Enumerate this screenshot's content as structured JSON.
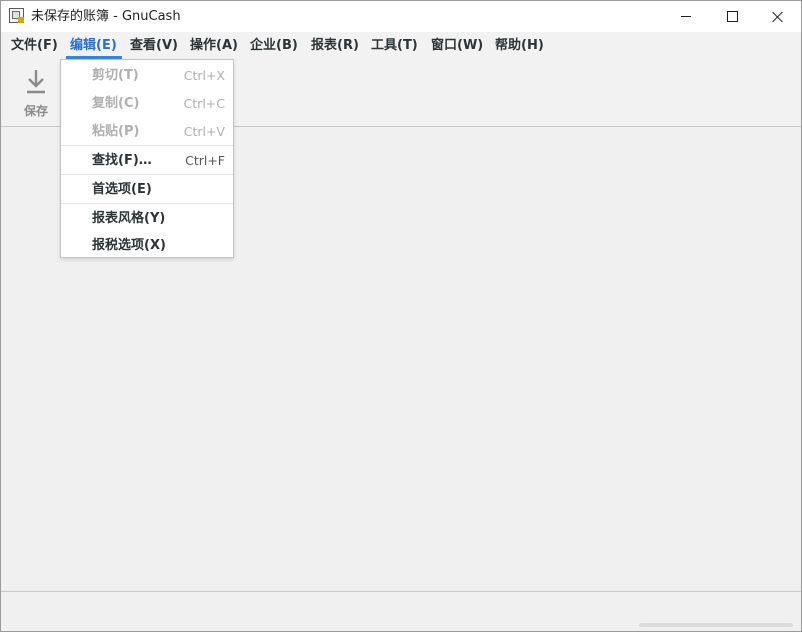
{
  "window": {
    "title": "未保存的账簿 - GnuCash",
    "icon": "gnucash-app-icon"
  },
  "menubar": [
    {
      "label": "文件(F)"
    },
    {
      "label": "编辑(E)",
      "active": true
    },
    {
      "label": "查看(V)"
    },
    {
      "label": "操作(A)"
    },
    {
      "label": "企业(B)"
    },
    {
      "label": "报表(R)"
    },
    {
      "label": "工具(T)"
    },
    {
      "label": "窗口(W)"
    },
    {
      "label": "帮助(H)"
    }
  ],
  "toolbar": {
    "save": {
      "label": "保存",
      "icon": "save-download-icon",
      "enabled": false
    }
  },
  "edit_menu": {
    "items": [
      {
        "label": "剪切(T)",
        "accel": "Ctrl+X",
        "enabled": false
      },
      {
        "label": "复制(C)",
        "accel": "Ctrl+C",
        "enabled": false
      },
      {
        "label": "粘贴(P)",
        "accel": "Ctrl+V",
        "enabled": false
      },
      {
        "label": "查找(F)…",
        "accel": "Ctrl+F",
        "enabled": true
      },
      {
        "label": "首选项(E)",
        "accel": "",
        "enabled": true
      },
      {
        "label": "报表风格(Y)",
        "accel": "",
        "enabled": true
      },
      {
        "label": "报税选项(X)",
        "accel": "",
        "enabled": true
      }
    ]
  },
  "colors": {
    "accent": "#3584e4",
    "active_menu_text": "#2a6fcb",
    "disabled_text": "#b0b0b0"
  }
}
